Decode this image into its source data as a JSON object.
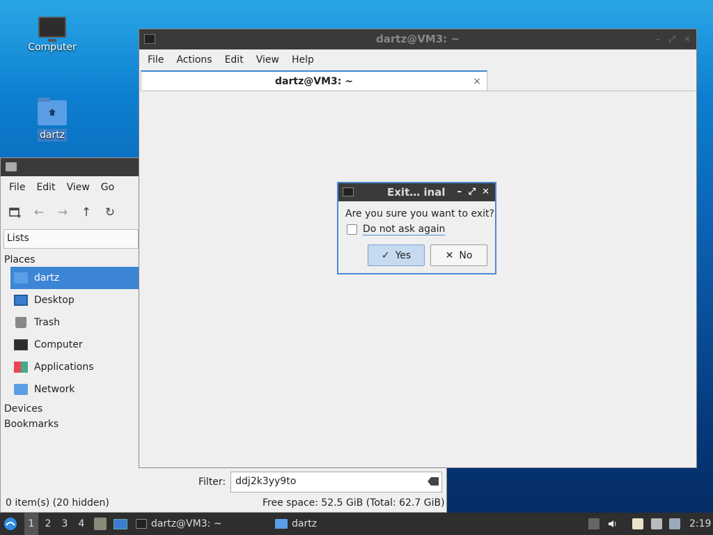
{
  "desktop": {
    "icons": [
      {
        "label": "Computer"
      },
      {
        "label": "dartz"
      }
    ]
  },
  "file_manager": {
    "menu": [
      "File",
      "Edit",
      "View",
      "Go"
    ],
    "panel_mode": "Lists",
    "places_header": "Places",
    "places": [
      "dartz",
      "Desktop",
      "Trash",
      "Computer",
      "Applications",
      "Network"
    ],
    "devices_header": "Devices",
    "bookmarks_header": "Bookmarks",
    "filter_label": "Filter:",
    "filter_value": "ddj2k3yy9to",
    "status_left": "0 item(s) (20 hidden)",
    "status_right": "Free space: 52.5 GiB (Total: 62.7 GiB)"
  },
  "terminal": {
    "title": "dartz@VM3: ~",
    "menu": [
      "File",
      "Actions",
      "Edit",
      "View",
      "Help"
    ],
    "tab_label": "dartz@VM3: ~",
    "tab_close": "×"
  },
  "dialog": {
    "title": "Exit… inal",
    "question": "Are you sure you want to exit?",
    "checkbox_label": "Do not ask again",
    "yes_label": "Yes",
    "no_label": "No"
  },
  "taskbar": {
    "workspaces": [
      "1",
      "2",
      "3",
      "4"
    ],
    "tasks": [
      "dartz@VM3: ~",
      "dartz"
    ],
    "clock": "2:19"
  },
  "colors": {
    "accent": "#3d85d6",
    "titlebar": "#3a3a3a",
    "panel": "#2e2e2e"
  }
}
